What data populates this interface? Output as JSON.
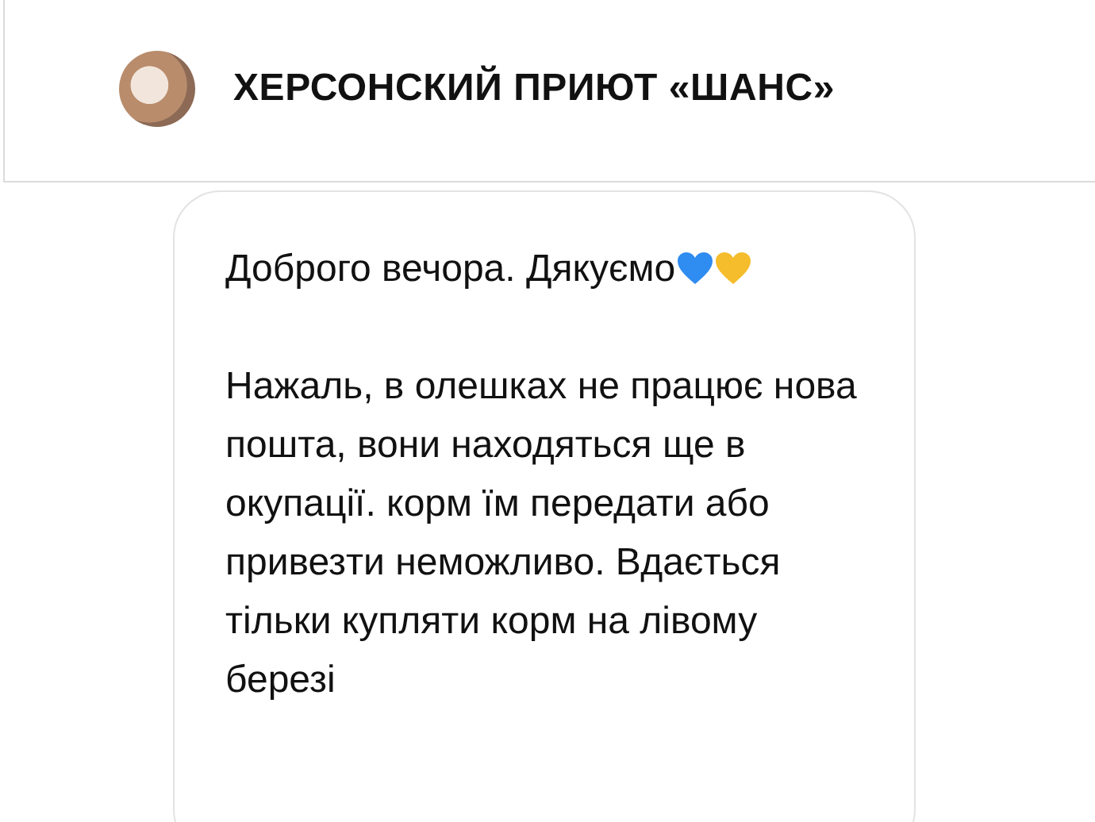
{
  "header": {
    "title": "ХЕРСОНСКИЙ ПРИЮТ «ШАНС»"
  },
  "message": {
    "greeting": "Доброго вечора. Дякуємо",
    "hearts": [
      {
        "color": "#2f8cf0"
      },
      {
        "color": "#f5bd2c"
      }
    ],
    "body": "Нажаль, в олешках не працює нова пошта, вони находяться ще в окупації. корм їм передати або привезти неможливо. Вдається тільки купляти корм на лівому березі"
  }
}
